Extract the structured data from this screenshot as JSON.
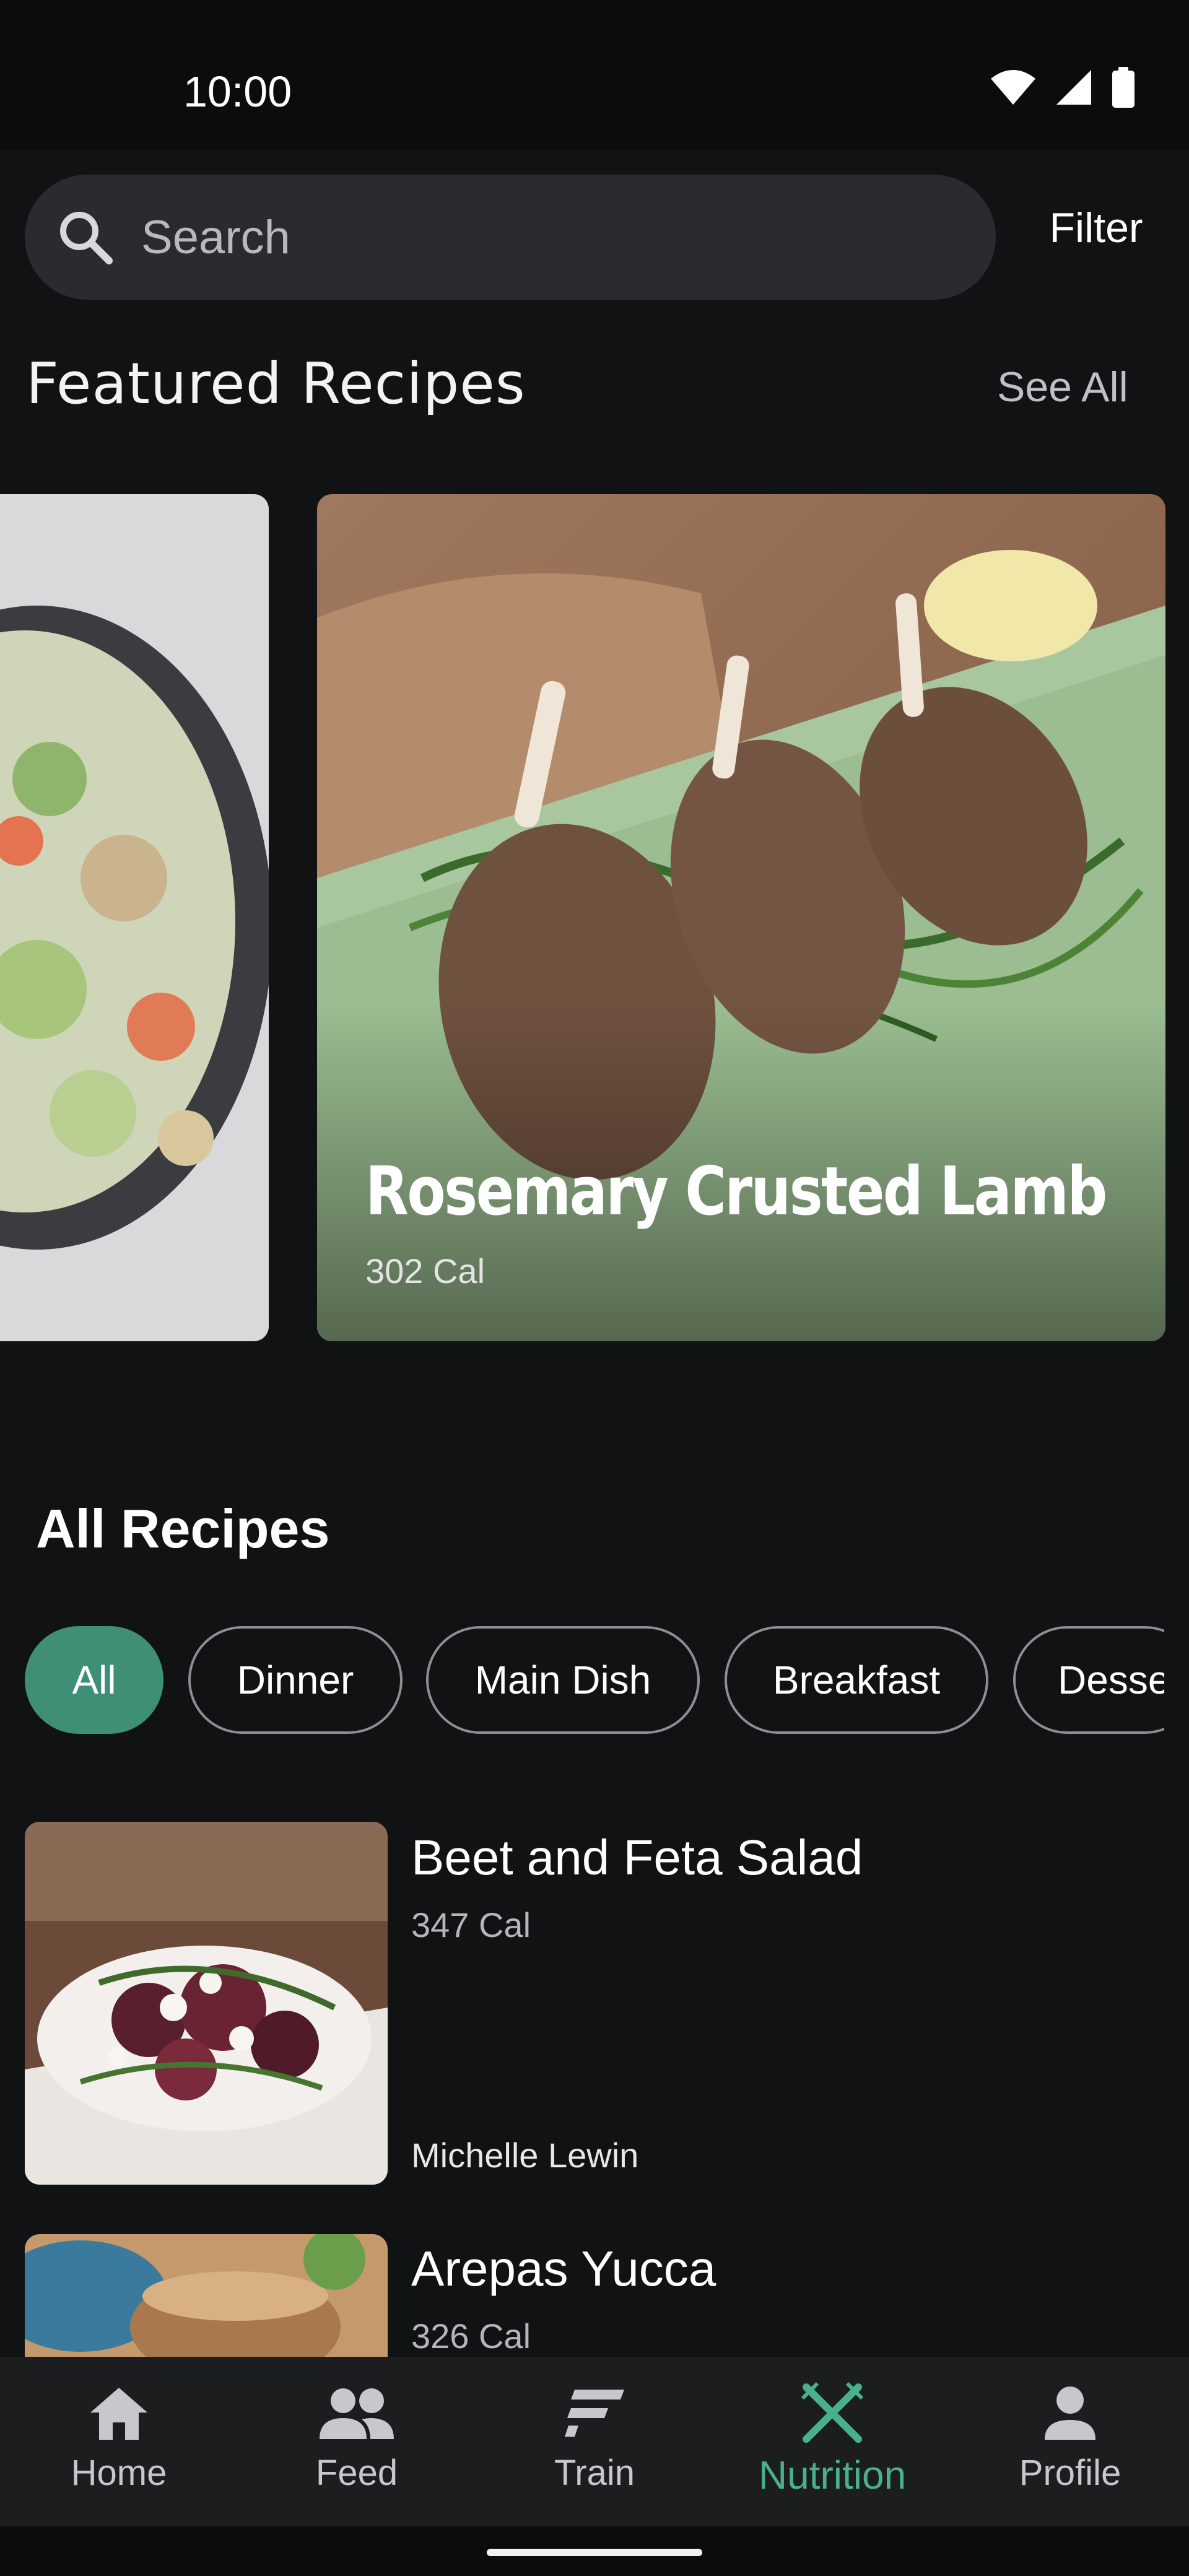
{
  "status_bar": {
    "time": "10:00"
  },
  "search": {
    "placeholder": "Search",
    "filter_label": "Filter"
  },
  "featured": {
    "title": "Featured Recipes",
    "see_all_label": "See All",
    "card": {
      "name": "Rosemary Crusted Lamb",
      "calories": "302 Cal"
    }
  },
  "all_recipes": {
    "title": "All Recipes",
    "chips": [
      "All",
      "Dinner",
      "Main Dish",
      "Breakfast",
      "Desse"
    ],
    "active_chip": "All",
    "items": [
      {
        "name": "Beet and Feta Salad",
        "calories": "347 Cal",
        "author": "Michelle Lewin"
      },
      {
        "name": "Arepas Yucca",
        "calories": "326 Cal"
      }
    ]
  },
  "nav": {
    "items": [
      {
        "label": "Home",
        "icon": "home-icon"
      },
      {
        "label": "Feed",
        "icon": "people-icon"
      },
      {
        "label": "Train",
        "icon": "train-icon"
      },
      {
        "label": "Nutrition",
        "icon": "fork-knife-icon"
      },
      {
        "label": "Profile",
        "icon": "person-icon"
      }
    ],
    "active": "Nutrition"
  },
  "colors": {
    "accent": "#3f8f76",
    "accent_text": "#49b08e",
    "background": "#111214"
  }
}
